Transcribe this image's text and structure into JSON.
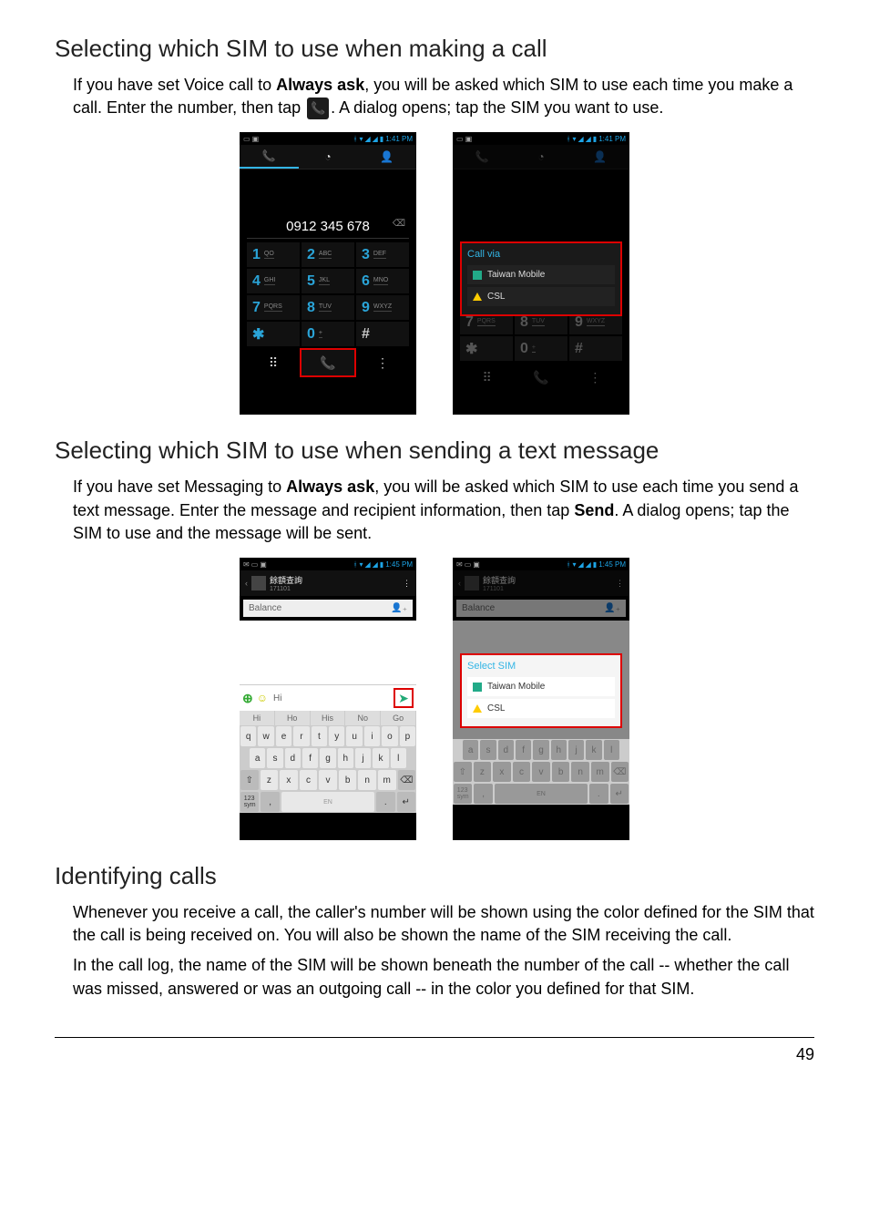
{
  "section1": {
    "title": "Selecting which SIM to use when making a call",
    "para_a": "If you have set Voice call to ",
    "bold_a": "Always ask",
    "para_b": ", you will be asked which SIM to use each time you make a call. Enter the number, then tap ",
    "para_c": ". A dialog opens; tap the SIM you want to use."
  },
  "dialer": {
    "time": "1:41 PM",
    "number": "0912 345 678",
    "keys": [
      {
        "d": "1",
        "s": "QO"
      },
      {
        "d": "2",
        "s": "ABC"
      },
      {
        "d": "3",
        "s": "DEF"
      },
      {
        "d": "4",
        "s": "GHI"
      },
      {
        "d": "5",
        "s": "JKL"
      },
      {
        "d": "6",
        "s": "MNO"
      },
      {
        "d": "7",
        "s": "PQRS"
      },
      {
        "d": "8",
        "s": "TUV"
      },
      {
        "d": "9",
        "s": "WXYZ"
      },
      {
        "d": "✱",
        "s": ""
      },
      {
        "d": "0",
        "s": "+"
      },
      {
        "d": "#",
        "s": ""
      }
    ],
    "callvia": "Call via",
    "sim1": "Taiwan Mobile",
    "sim2": "CSL"
  },
  "section2": {
    "title": "Selecting which SIM to use when sending a text message",
    "para_a": "If you have set Messaging to ",
    "bold_a": "Always ask",
    "para_b": ", you will be asked which SIM to use each time you send a text message. Enter the message and recipient information, then tap ",
    "bold_b": "Send",
    "para_c": ". A dialog opens; tap the SIM to use and the message will be sent."
  },
  "msg": {
    "time": "1:45 PM",
    "contact": "餘額查詢",
    "contact_sub": "171101",
    "to": "Balance",
    "input": "Hi",
    "suggestions": [
      "Hi",
      "Ho",
      "His",
      "No",
      "Go"
    ],
    "kb_r1": [
      "q",
      "w",
      "e",
      "r",
      "t",
      "y",
      "u",
      "i",
      "o",
      "p"
    ],
    "kb_r2": [
      "a",
      "s",
      "d",
      "f",
      "g",
      "h",
      "j",
      "k",
      "l"
    ],
    "kb_r3": [
      "⇧",
      "z",
      "x",
      "c",
      "v",
      "b",
      "n",
      "m",
      "⌫"
    ],
    "select_title": "Select SIM",
    "sim1": "Taiwan Mobile",
    "sim2": "CSL"
  },
  "section3": {
    "title": "Identifying calls",
    "p1": "Whenever you receive a call, the caller's number will be shown using the color defined for the SIM that the call is being received on. You will also be shown the name of the SIM receiving the call.",
    "p2": "In the call log, the name of the SIM will be shown beneath the number of the call -- whether the call was missed, answered or was an outgoing call -- in the color you defined for that SIM."
  },
  "page_number": "49"
}
